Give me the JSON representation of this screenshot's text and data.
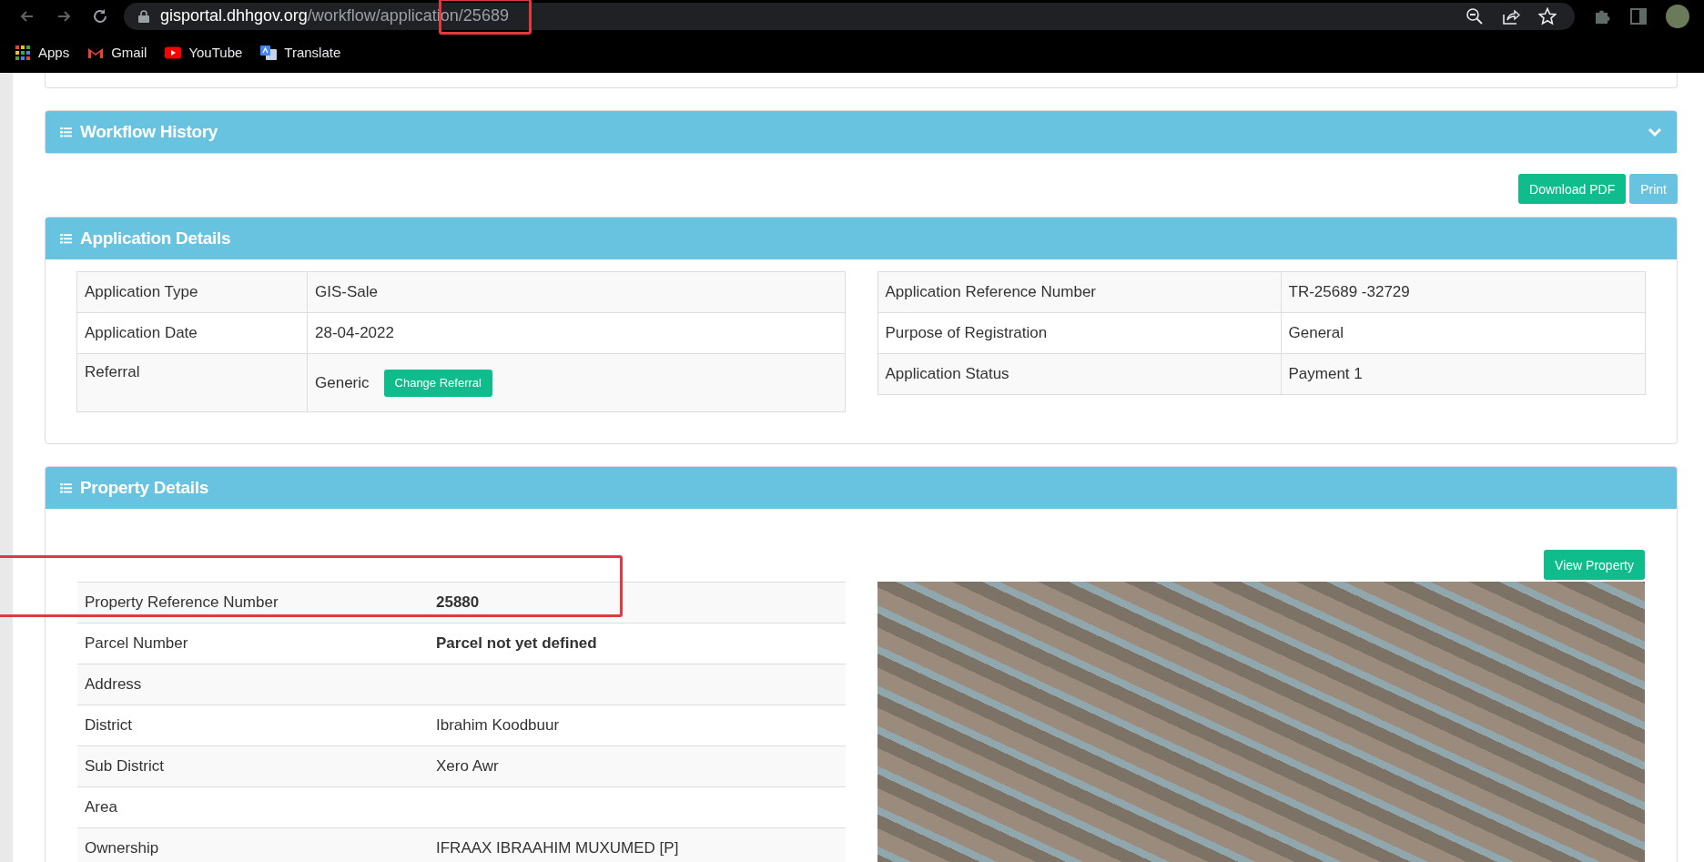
{
  "browser": {
    "url_host": "gisportal.dhhgov.org",
    "url_path": "/workflow/application/25689",
    "bookmarks": [
      {
        "label": "Apps",
        "kind": "apps"
      },
      {
        "label": "Gmail",
        "kind": "gmail"
      },
      {
        "label": "YouTube",
        "kind": "youtube"
      },
      {
        "label": "Translate",
        "kind": "translate"
      }
    ]
  },
  "workflow_history": {
    "title": "Workflow History",
    "expanded": false
  },
  "actions": [
    {
      "label": "Download PDF",
      "kind": "success"
    },
    {
      "label": "Print",
      "kind": "info"
    }
  ],
  "application_details": {
    "title": "Application Details",
    "left_rows": [
      {
        "label": "Application Type",
        "value": "GIS-Sale"
      },
      {
        "label": "Application Date",
        "value": "28-04-2022"
      },
      {
        "label": "Referral",
        "value": "Generic",
        "button": "Change Referral"
      }
    ],
    "right_rows": [
      {
        "label": "Application Reference Number",
        "value": "TR-25689 -32729"
      },
      {
        "label": "Purpose of Registration",
        "value": "General"
      },
      {
        "label": "Application Status",
        "value": "Payment 1"
      }
    ]
  },
  "property_details": {
    "title": "Property Details",
    "button": "View Property",
    "rows": [
      {
        "label": "Property Reference Number",
        "value": "25880",
        "emphasized": true
      },
      {
        "label": "Parcel Number",
        "value": "Parcel not yet defined",
        "emphasized": true
      },
      {
        "label": "Address",
        "value": ""
      },
      {
        "label": "District",
        "value": "Ibrahim Koodbuur",
        "emphasized": false
      },
      {
        "label": "Sub District",
        "value": "Xero Awr",
        "emphasized": false
      },
      {
        "label": "Area",
        "value": ""
      },
      {
        "label": "Ownership",
        "value": "IFRAAX IBRAAHIM MUXUMED [P]",
        "emphasized": false
      }
    ]
  }
}
